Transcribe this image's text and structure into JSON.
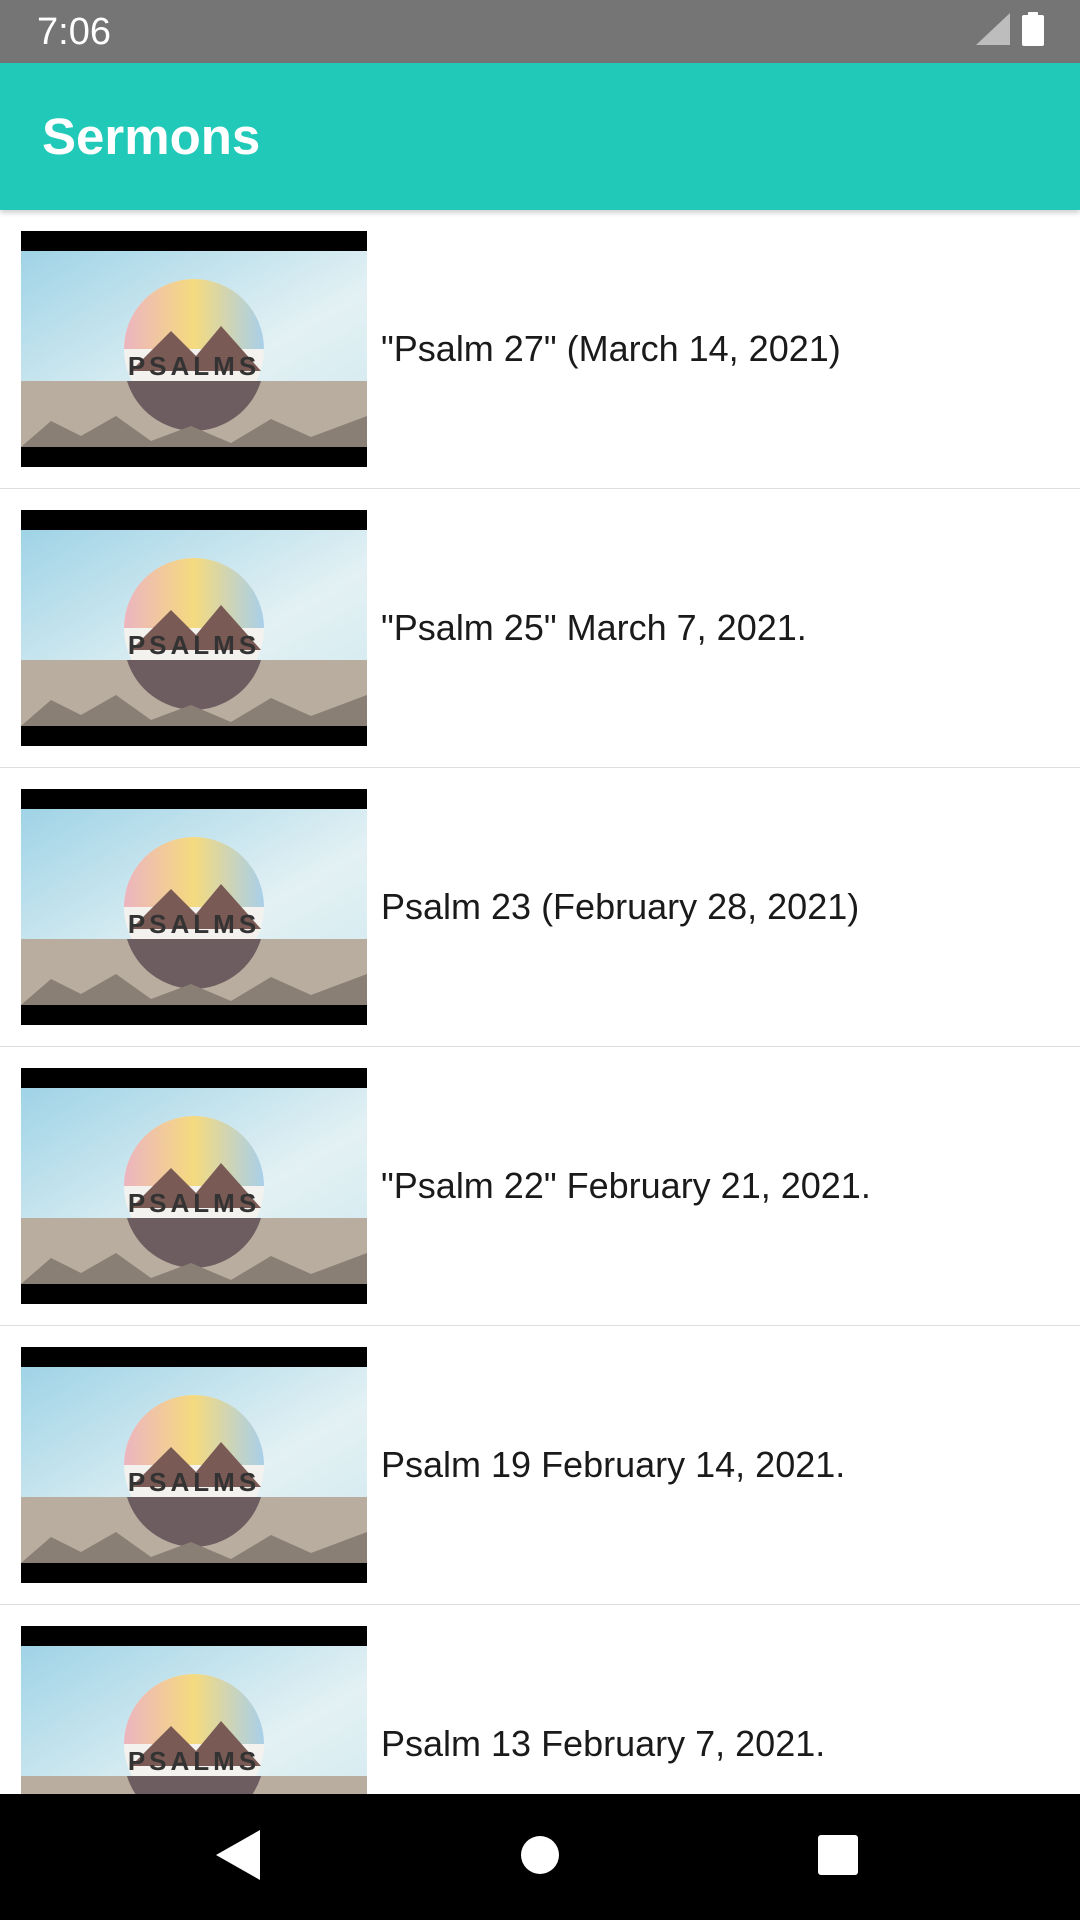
{
  "status_bar": {
    "time": "7:06",
    "icons": [
      "signal-icon",
      "battery-icon"
    ]
  },
  "app_bar": {
    "title": "Sermons"
  },
  "sermons": [
    {
      "title": "\"Psalm 27\" (March 14, 2021)",
      "thumbnail_text": "PSALMS"
    },
    {
      "title": "\"Psalm 25\" March 7, 2021.",
      "thumbnail_text": "PSALMS"
    },
    {
      "title": "Psalm 23 (February 28, 2021)",
      "thumbnail_text": "PSALMS"
    },
    {
      "title": "\"Psalm 22\" February 21, 2021.",
      "thumbnail_text": "PSALMS"
    },
    {
      "title": "Psalm 19 February 14, 2021.",
      "thumbnail_text": "PSALMS"
    },
    {
      "title": "Psalm 13 February 7, 2021.",
      "thumbnail_text": "PSALMS"
    }
  ],
  "nav_bar": {
    "icons": [
      "back-icon",
      "home-icon",
      "recents-icon"
    ]
  },
  "colors": {
    "app_bar": "#20c9b8",
    "status_bar": "#757575",
    "nav_bar": "#000000"
  }
}
